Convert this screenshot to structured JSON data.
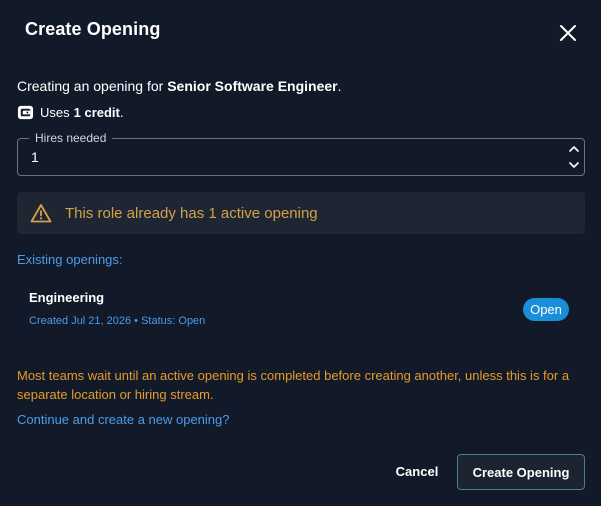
{
  "dialog": {
    "title": "Create Opening",
    "intro_prefix": "Creating an opening for ",
    "role_name": "Senior Software Engineer",
    "intro_suffix": ".",
    "credit_prefix": "Uses",
    "credit_amount": "1 credit",
    "credit_suffix": "."
  },
  "hires_field": {
    "label": "Hires needed",
    "value": "1"
  },
  "warning": {
    "text": "This role already has 1 active opening"
  },
  "existing": {
    "label": "Existing openings:",
    "openings": [
      {
        "name": "Engineering",
        "meta": "Created Jul 21, 2026 • Status: Open",
        "status": "Open"
      }
    ]
  },
  "advice": "Most teams wait until an active opening is completed before creating another, unless this is for a separate location or hiring stream.",
  "continue_link": "Continue and create a new opening?",
  "actions": {
    "cancel_label": "Cancel",
    "create_label": "Create Opening"
  },
  "colors": {
    "background": "#121a29",
    "link": "#4d9be8",
    "warning_text": "#d4a04a",
    "advice_text": "#e69a2a",
    "badge": "#1a8fd9",
    "primary_border": "#3a8a6e"
  },
  "icons": {
    "close": "close-icon",
    "wallet": "wallet-icon",
    "warning": "warning-triangle-icon",
    "stepper_up": "chevron-up-icon",
    "stepper_down": "chevron-down-icon"
  }
}
